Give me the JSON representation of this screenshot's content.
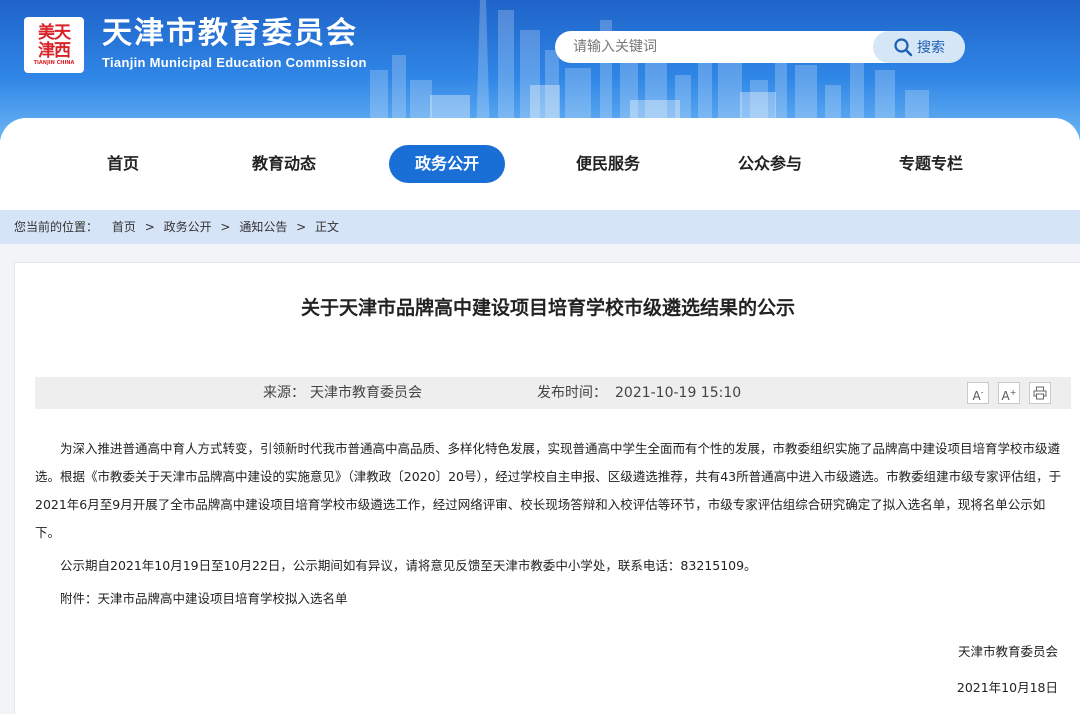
{
  "header": {
    "logo_text_top": "美天",
    "logo_text_bottom": "津西",
    "logo_caption": "TIANJIN CHINA",
    "title": "天津市教育委员会",
    "subtitle": "Tianjin Municipal Education Commission",
    "search_placeholder": "请输入关键词",
    "search_button": "搜索"
  },
  "nav": {
    "items": [
      {
        "label": "首页"
      },
      {
        "label": "教育动态"
      },
      {
        "label": "政务公开"
      },
      {
        "label": "便民服务"
      },
      {
        "label": "公众参与"
      },
      {
        "label": "专题专栏"
      }
    ],
    "active_index": 2
  },
  "breadcrumb": {
    "prefix": "您当前的位置：",
    "items": [
      "首页",
      "政务公开",
      "通知公告",
      "正文"
    ],
    "separator": ">"
  },
  "article": {
    "title": "关于天津市品牌高中建设项目培育学校市级遴选结果的公示",
    "source_label": "来源：",
    "source": "天津市教育委员会",
    "date_label": "发布时间：",
    "date": "2021-10-19 15:10",
    "tools": {
      "font_smaller": "A",
      "font_larger": "A",
      "print": "print-icon"
    },
    "paragraphs": [
      "为深入推进普通高中育人方式转变，引领新时代我市普通高中高品质、多样化特色发展，实现普通高中学生全面而有个性的发展，市教委组织实施了品牌高中建设项目培育学校市级遴选。根据《市教委关于天津市品牌高中建设的实施意见》（津教政〔2020〕20号），经过学校自主申报、区级遴选推荐，共有43所普通高中进入市级遴选。市教委组建市级专家评估组，于2021年6月至9月开展了全市品牌高中建设项目培育学校市级遴选工作，经过网络评审、校长现场答辩和入校评估等环节，市级专家评估组综合研究确定了拟入选名单，现将名单公示如下。",
      "公示期自2021年10月19日至10月22日，公示期间如有异议，请将意见反馈至天津市教委中小学处，联系电话：83215109。",
      "附件：天津市品牌高中建设项目培育学校拟入选名单"
    ],
    "signature": "天津市教育委员会",
    "sign_date": "2021年10月18日"
  },
  "colors": {
    "banner": "#2f86e6",
    "nav_active": "#1a6fd6",
    "breadcrumb_bg": "#d6e4f7",
    "logo_red": "#d8232a"
  }
}
